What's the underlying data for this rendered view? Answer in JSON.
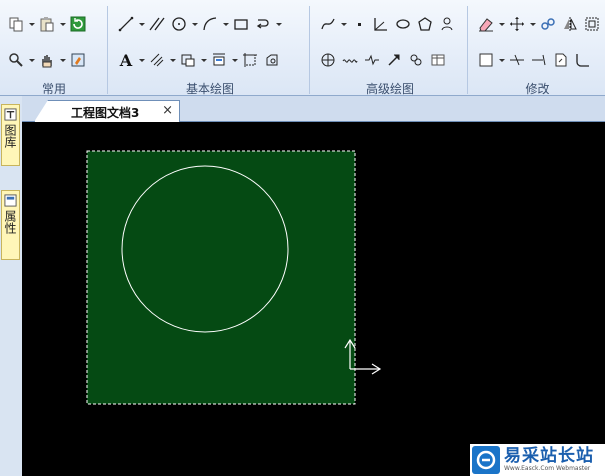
{
  "ribbon": {
    "groups": [
      {
        "label": "常用"
      },
      {
        "label": "基本绘图"
      },
      {
        "label": "高级绘图"
      },
      {
        "label": "修改"
      }
    ],
    "text_tool_glyph": "A"
  },
  "side_tabs": [
    {
      "label": "图库",
      "icon": "library-icon"
    },
    {
      "label": "属性",
      "icon": "properties-icon"
    }
  ],
  "document": {
    "tab_title": "工程图文档3",
    "close_glyph": "×"
  },
  "canvas": {
    "background": "#000000",
    "sheet_color": "#054a13",
    "line_color": "#ffffff"
  },
  "watermark": {
    "title": "易采站长站",
    "url": "Www.Easck.Com Webmaster"
  }
}
